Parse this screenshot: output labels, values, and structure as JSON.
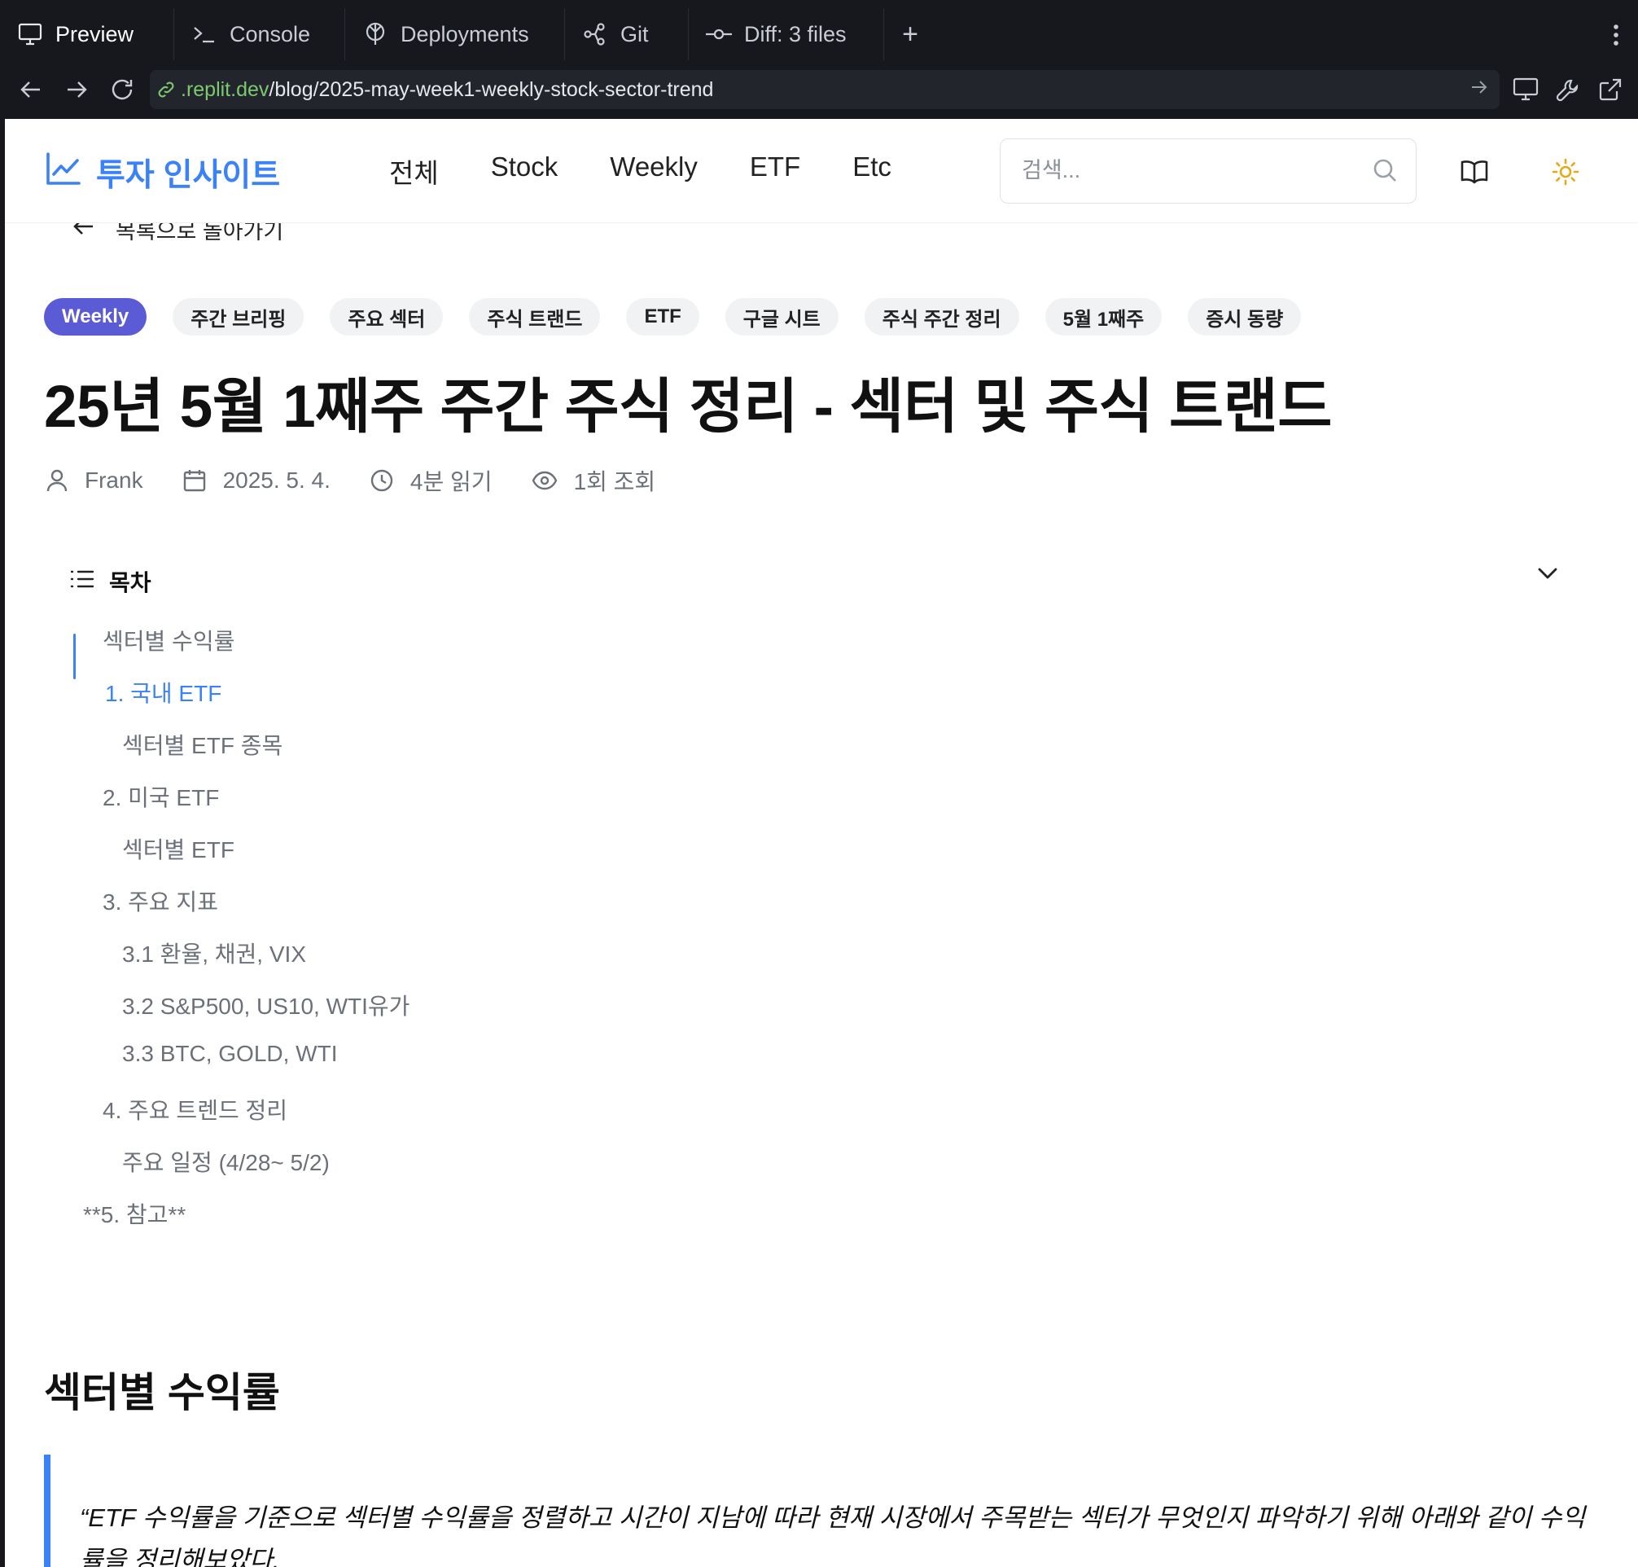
{
  "ide": {
    "tabs": [
      {
        "label": "Preview",
        "icon": "monitor-icon"
      },
      {
        "label": "Console",
        "icon": "terminal-icon"
      },
      {
        "label": "Deployments",
        "icon": "deploy-icon"
      },
      {
        "label": "Git",
        "icon": "git-icon"
      },
      {
        "label": "Diff: 3 files",
        "icon": "commit-icon"
      }
    ],
    "add_tab": "+"
  },
  "browser": {
    "url_host": ".replit.dev",
    "url_path": "/blog/2025-may-week1-weekly-stock-sector-trend"
  },
  "site": {
    "logo_text": "투자 인사이트",
    "nav": [
      "전체",
      "Stock",
      "Weekly",
      "ETF",
      "Etc"
    ],
    "search_placeholder": "검색...",
    "accent_color": "#3b82f6"
  },
  "post": {
    "back_label": "목록으로 돌아가기",
    "tags": [
      "Weekly",
      "주간 브리핑",
      "주요 섹터",
      "주식 트랜드",
      "ETF",
      "구글 시트",
      "주식 주간 정리",
      "5월 1째주",
      "증시 동량"
    ],
    "title": "25년 5월 1째주 주간 주식 정리 - 섹터 및 주식 트랜드",
    "author": "Frank",
    "date": "2025. 5. 4.",
    "read_time": "4분 읽기",
    "views": "1회 조회"
  },
  "toc": {
    "title": "목차",
    "items": [
      "섹터별 수익률",
      "1. 국내 ETF",
      "섹터별 ETF 종목",
      "2. 미국 ETF",
      "섹터별 ETF",
      "3. 주요 지표",
      "3.1 환율, 채권, VIX",
      "3.2 S&P500, US10, WTI유가",
      "3.3 BTC, GOLD, WTI",
      "4. 주요 트렌드 정리",
      "주요 일정 (4/28~ 5/2)",
      "**5. 참고**"
    ]
  },
  "section": {
    "heading": "섹터별 수익률",
    "quote": "“ETF 수익률을 기준으로 섹터별 수익률을 정렬하고 시간이 지남에 따라 현재 시장에서 주목받는 섹터가 무엇인지 파악하기 위해 아래와 같이 수익률을 정리해보았다."
  }
}
